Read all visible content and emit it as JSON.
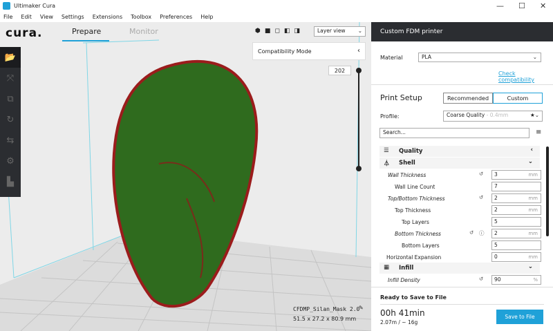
{
  "window": {
    "title": "Ultimaker Cura",
    "min": "—",
    "max": "☐",
    "close": "✕"
  },
  "menu": [
    "File",
    "Edit",
    "View",
    "Settings",
    "Extensions",
    "Toolbox",
    "Preferences",
    "Help"
  ],
  "header": {
    "logo": "cura.",
    "tabs": [
      "Prepare",
      "Monitor"
    ],
    "active_tab": "Prepare",
    "view_select": "Layer view"
  },
  "compat": {
    "label": "Compatibility Mode"
  },
  "layer": {
    "value": "202"
  },
  "model": {
    "name": "CFDMP_Silan_Mask 2.0",
    "dims": "51.5 x 27.2 x 80.9 mm"
  },
  "panel": {
    "printer": "Custom FDM printer",
    "material_label": "Material",
    "material": "PLA",
    "check": "Check compatibility",
    "setup_title": "Print Setup",
    "mode_recommended": "Recommended",
    "mode_custom": "Custom",
    "profile_label": "Profile:",
    "profile": "Coarse Quality",
    "profile_sub": " - 0.4mm",
    "search_placeholder": "Search...",
    "categories": {
      "quality": "Quality",
      "shell": "Shell",
      "infill": "Infill"
    },
    "settings": [
      {
        "label": "Wall Thickness",
        "value": "3",
        "unit": "mm"
      },
      {
        "label": "Wall Line Count",
        "value": "7",
        "unit": ""
      },
      {
        "label": "Top/Bottom Thickness",
        "value": "2",
        "unit": "mm"
      },
      {
        "label": "Top Thickness",
        "value": "2",
        "unit": "mm"
      },
      {
        "label": "Top Layers",
        "value": "5",
        "unit": ""
      },
      {
        "label": "Bottom Thickness",
        "value": "2",
        "unit": "mm"
      },
      {
        "label": "Bottom Layers",
        "value": "5",
        "unit": ""
      },
      {
        "label": "Horizontal Expansion",
        "value": "0",
        "unit": "mm"
      },
      {
        "label": "Infill Density",
        "value": "90",
        "unit": "%"
      }
    ],
    "ready": "Ready to Save to File",
    "time": "00h 41min",
    "usage": "2.07m / ~ 16g",
    "save": "Save to File"
  },
  "colors": {
    "accent": "#1fa1d8",
    "dark": "#2b2d31",
    "model": "#2f6b1e",
    "edge": "#9b1c1c"
  }
}
